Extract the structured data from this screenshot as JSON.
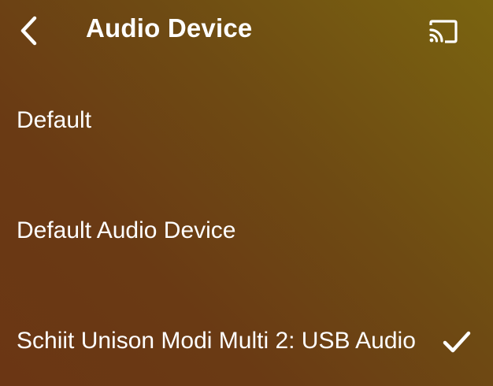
{
  "header": {
    "back_icon": "chevron-left-icon",
    "title": "Audio Device",
    "cast_icon": "cast-icon"
  },
  "devices": [
    {
      "label": "Default",
      "selected": false
    },
    {
      "label": "Default Audio Device",
      "selected": false
    },
    {
      "label": "Schiit Unison Modi Multi 2: USB Audio",
      "selected": true
    }
  ],
  "colors": {
    "text": "#ffffff",
    "gradient_top_right": "#7a6410",
    "gradient_bottom_left": "#6b3614"
  }
}
